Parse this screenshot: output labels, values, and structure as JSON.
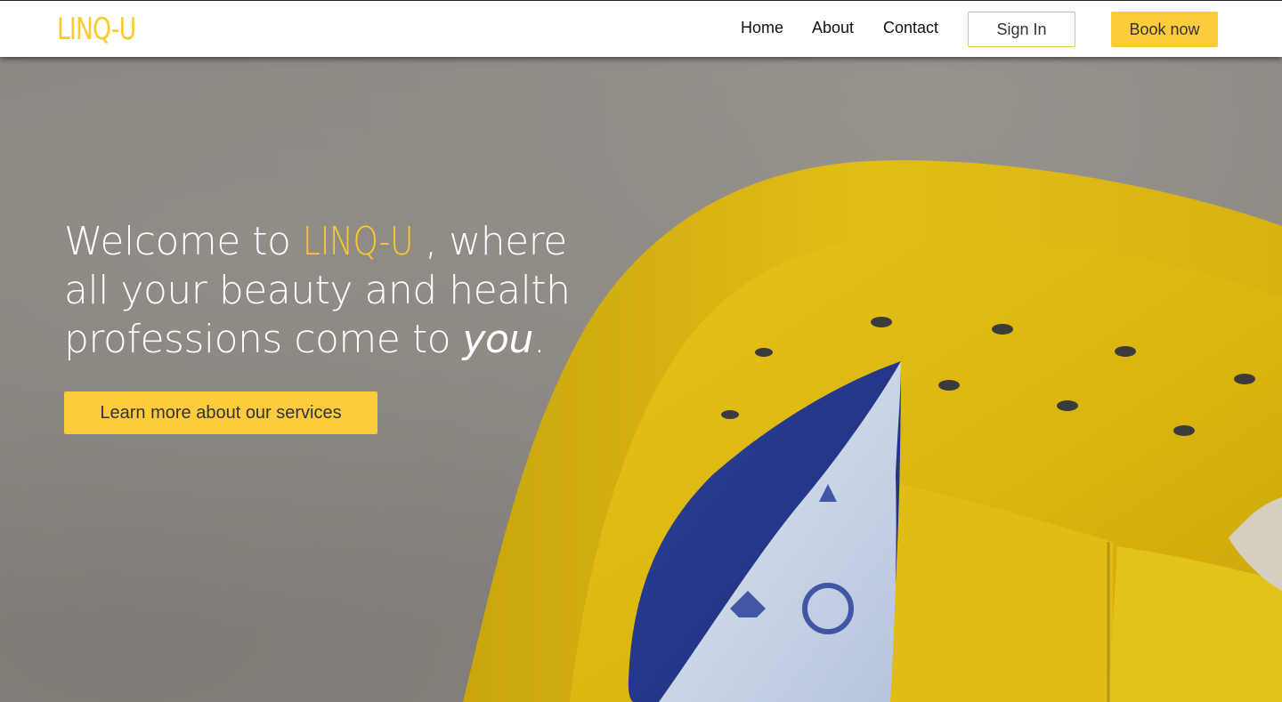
{
  "nav": {
    "logo": "LINQ-U",
    "links": [
      "Home",
      "About",
      "Contact"
    ],
    "signin_label": "Sign In",
    "book_label": "Book now"
  },
  "hero": {
    "headline_prefix": "Welcome to ",
    "headline_brand": "LINQ-U",
    "headline_middle": ", where all your beauty and health professions come to ",
    "headline_emphasis": "you",
    "headline_suffix": ".",
    "cta_label": "Learn more about our services"
  },
  "colors": {
    "accent": "#fdc92b",
    "button": "#fdcb3c",
    "background": "#8a8580"
  }
}
